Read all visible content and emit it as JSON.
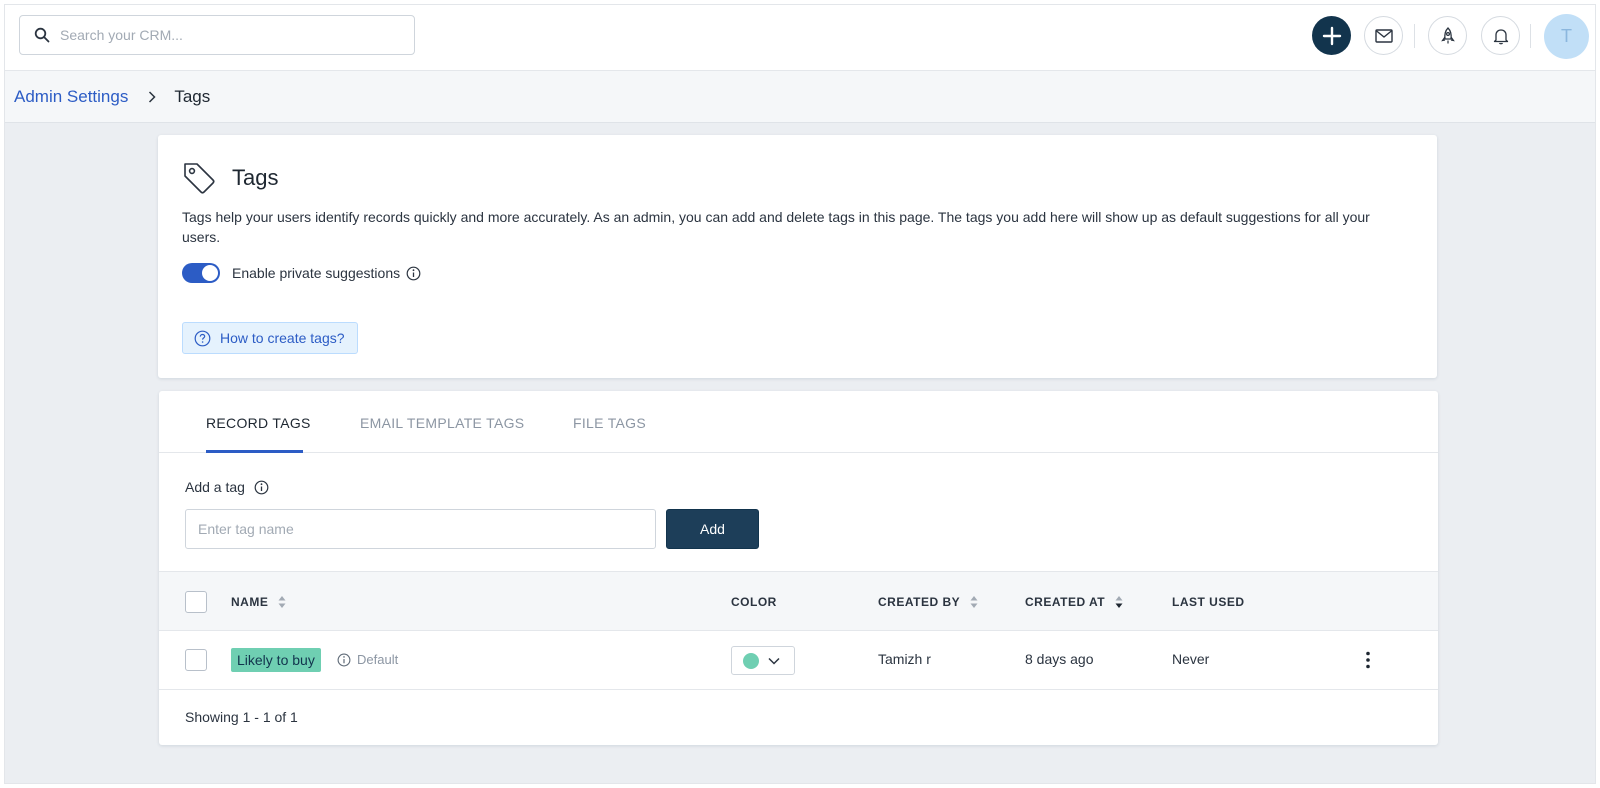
{
  "topbar": {
    "search_placeholder": "Search your CRM...",
    "avatar_initial": "T",
    "icons": [
      "search-icon",
      "plus-icon",
      "mail-icon",
      "rocket-icon",
      "bell-icon"
    ]
  },
  "breadcrumb": {
    "parent": "Admin Settings",
    "current": "Tags"
  },
  "header": {
    "title": "Tags",
    "description": "Tags help your users identify records quickly and more accurately. As an admin, you can add and delete tags in this page. The tags you add here will show up as default suggestions for all your users.",
    "toggle_label": "Enable private suggestions",
    "toggle_on": true,
    "help_link": "How to create tags?"
  },
  "tabs": [
    {
      "label": "RECORD TAGS",
      "active": true
    },
    {
      "label": "EMAIL TEMPLATE TAGS",
      "active": false
    },
    {
      "label": "FILE TAGS",
      "active": false
    }
  ],
  "add_tag": {
    "label": "Add a tag",
    "placeholder": "Enter tag name",
    "button": "Add"
  },
  "table": {
    "columns": [
      "NAME",
      "COLOR",
      "CREATED BY",
      "CREATED AT",
      "LAST USED"
    ],
    "rows": [
      {
        "name": "Likely to buy",
        "badge": "Default",
        "color": "#6fcfb2",
        "created_by": "Tamizh r",
        "created_at": "8 days ago",
        "last_used": "Never"
      }
    ],
    "footer": "Showing 1 - 1 of 1"
  },
  "colors": {
    "accent": "#2c5cc5",
    "primary_dark": "#12344d",
    "tag_green": "#6fcfb2"
  }
}
